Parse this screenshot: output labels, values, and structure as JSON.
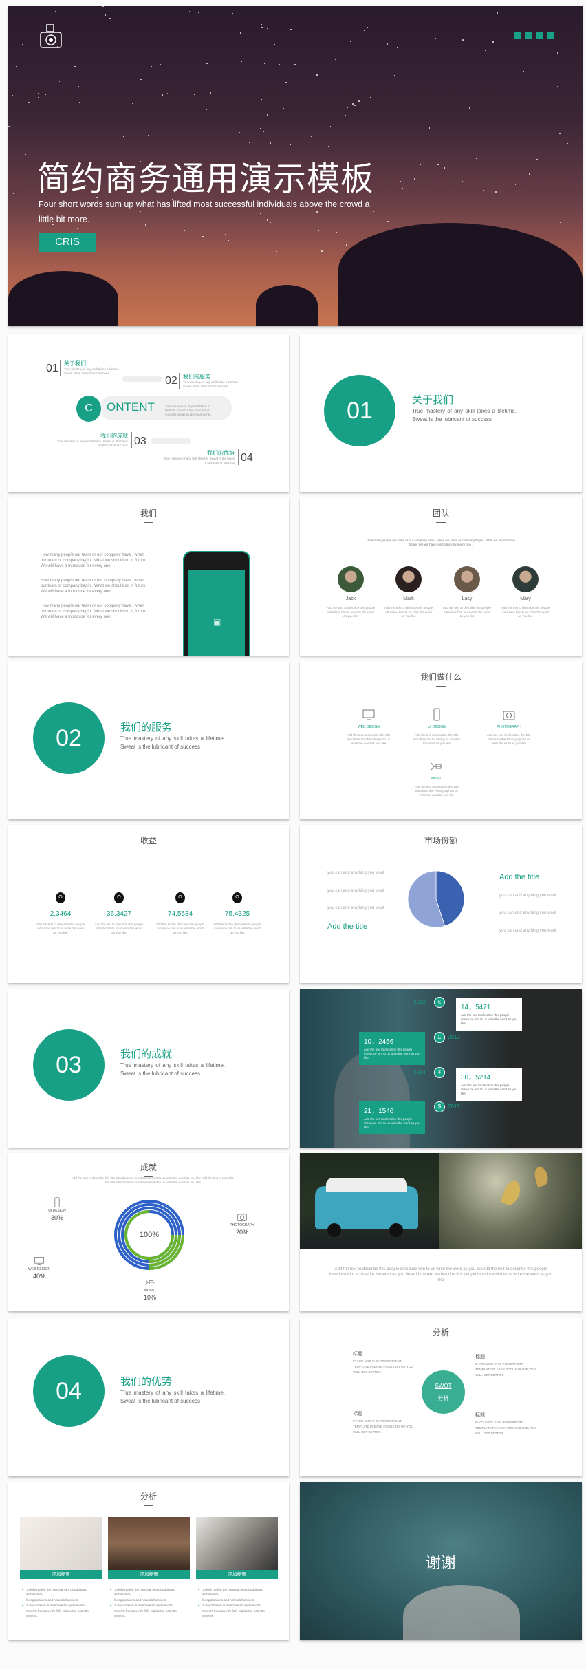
{
  "colors": {
    "accent": "#17a085",
    "pie_dark": "#3a62b0",
    "pie_light": "#8fa3d6",
    "ring_blue": "#2f62c8",
    "ring_green": "#6ab52f"
  },
  "cover": {
    "title": "简约商务通用演示模板",
    "subtitle": "Four short words sum up what has lifted most successful individuals above the crowd a little bit more.",
    "button": "CRIS",
    "logo_icon": "camera-icon",
    "menu_icon": "four-squares-icon"
  },
  "contents": {
    "c": "C",
    "word": "ONTENT",
    "desc": "True mastery of any skill takes a lifetime. Sweat is the lubricant of success,speak louder than words.",
    "items": [
      {
        "num": "01",
        "title": "关于我们",
        "desc": "True mastery of any skill takes a lifetime. Sweat is the lubricant of success"
      },
      {
        "num": "02",
        "title": "我们的服务",
        "desc": "True mastery of any skill takes a lifetime. Sweat is the lubricant of success"
      },
      {
        "num": "03",
        "title": "我们的成就",
        "desc": "True mastery of any skill lifetime. Sweat is the takes a lubricant of success"
      },
      {
        "num": "04",
        "title": "我们的优势",
        "desc": "True mastery of any skill lifetime. Sweat is the takes a lubricant of success"
      }
    ]
  },
  "sections": [
    {
      "num": "01",
      "title": "关于我们",
      "desc": "True mastery of any skill takes a lifetime. Sweat is the lubricant of success"
    },
    {
      "num": "02",
      "title": "我们的服务",
      "desc": "True mastery of any skill takes a lifetime. Sweat is the lubricant of success"
    },
    {
      "num": "03",
      "title": "我们的成就",
      "desc": "True mastery of any skill takes a lifetime. Sweat is the lubricant of success"
    },
    {
      "num": "04",
      "title": "我们的优势",
      "desc": "True mastery of any skill takes a lifetime. Sweat is the lubricant of success"
    }
  ],
  "about": {
    "title": "我们",
    "paras": [
      "How many people our team or our company have , when our team or company begin . What we should do in future. We will have a introduce for every one",
      "How many people our team or our company have , when our team or company begin . What we should do in future. We will have a introduce for every one",
      "How many people our team or our company have , when our team or company begin . What we should do in future. We will have a introduce for every one"
    ]
  },
  "team": {
    "title": "团队",
    "desc": "How many people our team or our company have , when our team or company begin . What we should do in future. We will have a introduce for every one .",
    "members": [
      {
        "name": "Jack",
        "desc": "Add the text to describe this people introduce him to us write the word as you like"
      },
      {
        "name": "Mark",
        "desc": "Add the text to describe this people introduce him to us write the word as you like"
      },
      {
        "name": "Lacy",
        "desc": "Add the text to describe this people introduce him to us write the word as you like"
      },
      {
        "name": "Mary",
        "desc": "Add the text to describe this people introduce him to us write the word as you like"
      }
    ]
  },
  "services": {
    "title": "我们做什么",
    "items": [
      {
        "label": "WEB DESIGN",
        "icon": "monitor-icon",
        "desc": "Add the text to describe this title introduce the Web design to us write the word as you like"
      },
      {
        "label": "UI DESIGN",
        "icon": "phone-icon",
        "desc": "Add the text to describe this title introduce the UI design to us write the word as you like"
      },
      {
        "label": "PHOTOGRAPH",
        "icon": "camera-icon",
        "desc": "Add the text to describe this title introduce the Photograph to us write the word as you like"
      },
      {
        "label": "MUSIC",
        "icon": "trumpet-icon",
        "desc": "Add the text to describe this title introduce the Photograph to us write the word as you like"
      }
    ]
  },
  "revenue": {
    "title": "收益",
    "items": [
      {
        "value": "2,3464",
        "desc": "Add the text to describe this people introduce him to us write the word as you like"
      },
      {
        "value": "36,3427",
        "desc": "Add the text to describe this people introduce him to us write the word as you like"
      },
      {
        "value": "74,5534",
        "desc": "Add the text to describe this people introduce him to us write the word as you like"
      },
      {
        "value": "75,4325",
        "desc": "Add the text to describe this people introduce him to us write the word as you like"
      }
    ],
    "icon": "money-bag-icon"
  },
  "market": {
    "title": "市场份额",
    "left_texts": [
      "you can add anything you want",
      "you can add anything you want",
      "you can add anything you want"
    ],
    "left_title": "Add the title",
    "right_title": "Add the title",
    "right_texts": [
      "you can add anything you want",
      "you can add anything you want",
      "you can add anything you want"
    ],
    "chart_data": {
      "type": "pie",
      "values": [
        45,
        55
      ],
      "colors": [
        "#3a62b0",
        "#8fa3d6"
      ]
    }
  },
  "timeline": {
    "items": [
      {
        "year": "2012",
        "icon": "€",
        "value": "14，5471",
        "desc": "Add the text to describe this people introduce him to us write the word as you like"
      },
      {
        "year": "2013",
        "icon": "£",
        "value": "10，2456",
        "desc": "Add the text to describe this people introduce him to us write the word as you like"
      },
      {
        "year": "2014",
        "icon": "¥",
        "value": "30，5214",
        "desc": "Add the text to describe this people introduce him to us write the word as you like"
      },
      {
        "year": "2015",
        "icon": "$",
        "value": "21，1546",
        "desc": "Add the text to describe this people introduce him to us write the word as you like"
      }
    ]
  },
  "achieve": {
    "title": "成就",
    "desc": "Add the text to describe this title introduce the our achievement to us write the word as you like Add the text to describe this title introduce the our achievement to us write the word as you like",
    "center": "100%",
    "items": [
      {
        "label": "UI DESIGN",
        "pct": "30%"
      },
      {
        "label": "PHOTOGRAPH",
        "pct": "20%"
      },
      {
        "label": "WEB DESIGN",
        "pct": "40%"
      },
      {
        "label": "MUSIC",
        "pct": "10%"
      }
    ]
  },
  "gallery": {
    "text": "Add the text to describe this people introduce him to us write the word as you likeAdd the text to describe this people introduce him to us write the word as you likeAdd the text to describe this people introduce him to us write the word as you like"
  },
  "swot": {
    "title": "分析",
    "center1": "SWOT",
    "center2": "分析",
    "quads": [
      {
        "h": "标题",
        "t": "IF YOU LIKE THIS POWERPOINT TEMPLATE,PLEASE FOCUS ON ME,YOU WILL GET BETTER."
      },
      {
        "h": "标题",
        "t": "IF YOU LIKE THIS POWERPOINT TEMPLATE,PLEASE FOCUS ON ME,YOU WILL GET BETTER."
      },
      {
        "h": "标题",
        "t": "IF YOU LIKE THIS POWERPOINT TEMPLATE,PLEASE FOCUS ON ME,YOU WILL GET BETTER."
      },
      {
        "h": "标题",
        "t": "IF YOU LIKE THIS POWERPOINT TEMPLATE,PLEASE FOCUS ON ME,YOU WILL GET BETTER."
      }
    ]
  },
  "analysis": {
    "title": "分析",
    "cards": [
      {
        "label": "添加标语",
        "bullets": [
          "To fully realize the potential of a cloud-based architecture",
          "for applications and network functions.",
          "A cloud-based architecture for applications",
          "network functions. To fully realize the potential network."
        ]
      },
      {
        "label": "添加标语",
        "bullets": [
          "To fully realize the potential of a cloud-based architecture",
          "for applications and network functions.",
          "A cloud-based architecture for applications",
          "network functions. To fully realize the potential network."
        ]
      },
      {
        "label": "添加标语",
        "bullets": [
          "To fully realize the potential of a cloud-based architecture",
          "for applications and network functions.",
          "A cloud-based architecture for applications",
          "network functions. To fully realize the potential network."
        ]
      }
    ]
  },
  "thanks": {
    "title": "谢谢"
  }
}
